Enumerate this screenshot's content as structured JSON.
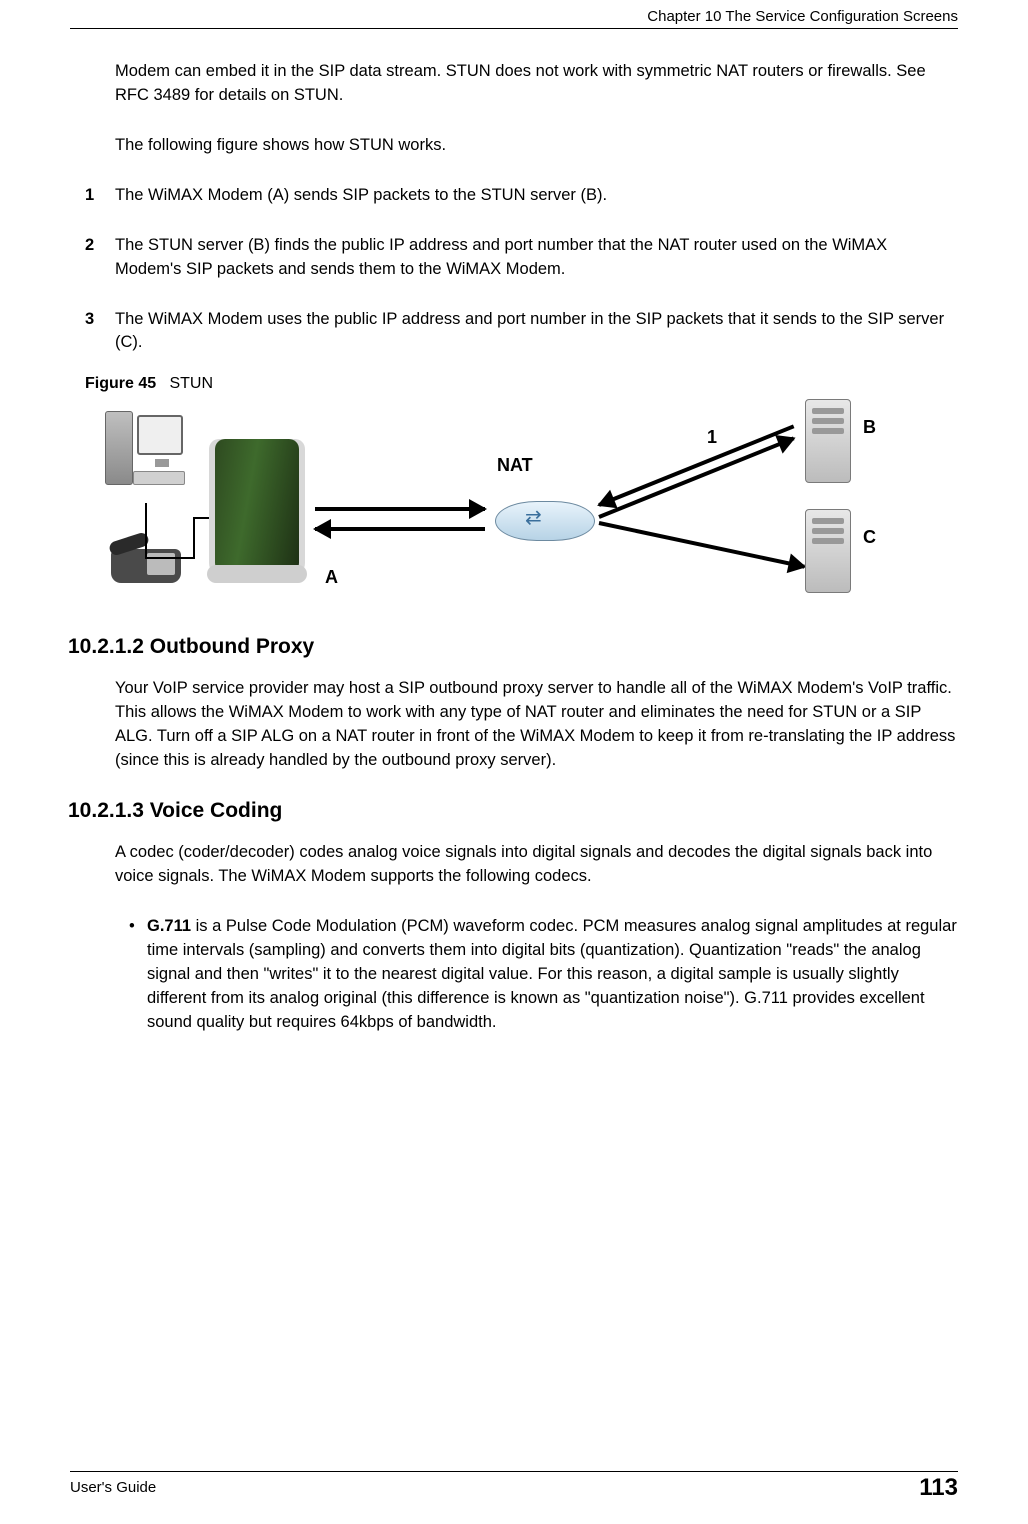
{
  "header": {
    "chapter": "Chapter 10 The Service Configuration Screens"
  },
  "intro": {
    "p1": "Modem can embed it in the SIP data stream. STUN does not work with symmetric NAT routers or firewalls. See RFC 3489 for details on STUN.",
    "p2": "The following figure shows how STUN works."
  },
  "steps": [
    {
      "num": "1",
      "text": "The WiMAX Modem (A) sends SIP packets to the STUN server (B)."
    },
    {
      "num": "2",
      "text": "The STUN server (B) finds the public IP address and port number that the NAT router used on the WiMAX Modem's SIP packets and sends them to the WiMAX Modem."
    },
    {
      "num": "3",
      "text": "The WiMAX Modem uses the public IP address and port number in the SIP packets that it sends to the SIP server (C)."
    }
  ],
  "figure": {
    "label_prefix": "Figure 45",
    "title": "STUN",
    "labels": {
      "A": "A",
      "NAT": "NAT",
      "one": "1",
      "B": "B",
      "C": "C"
    }
  },
  "sections": {
    "outbound": {
      "num_title": "10.2.1.2  Outbound Proxy",
      "body": "Your VoIP service provider may host a SIP outbound proxy server to handle all of the WiMAX Modem's VoIP traffic. This allows the WiMAX Modem to work with any type of NAT router and eliminates the need for STUN or a SIP ALG. Turn off a SIP ALG on a NAT router in front of the WiMAX Modem to keep it from re-translating the IP address (since this is already handled by the outbound proxy server)."
    },
    "voice": {
      "num_title": "10.2.1.3  Voice Coding",
      "body": "A codec (coder/decoder) codes analog voice signals into digital signals and decodes the digital signals back into voice signals. The WiMAX Modem supports the following codecs.",
      "bullet_bold": "G.711",
      "bullet_rest": " is a Pulse Code Modulation (PCM) waveform codec. PCM measures analog signal amplitudes at regular time intervals (sampling) and converts them into digital bits (quantization). Quantization \"reads\" the analog signal and then \"writes\" it to the nearest digital value. For this reason, a digital sample is usually slightly different from its analog original (this difference is known as \"quantization noise\"). G.711 provides excellent sound quality but requires 64kbps of bandwidth."
    }
  },
  "footer": {
    "left": "User's Guide",
    "page": "113"
  }
}
